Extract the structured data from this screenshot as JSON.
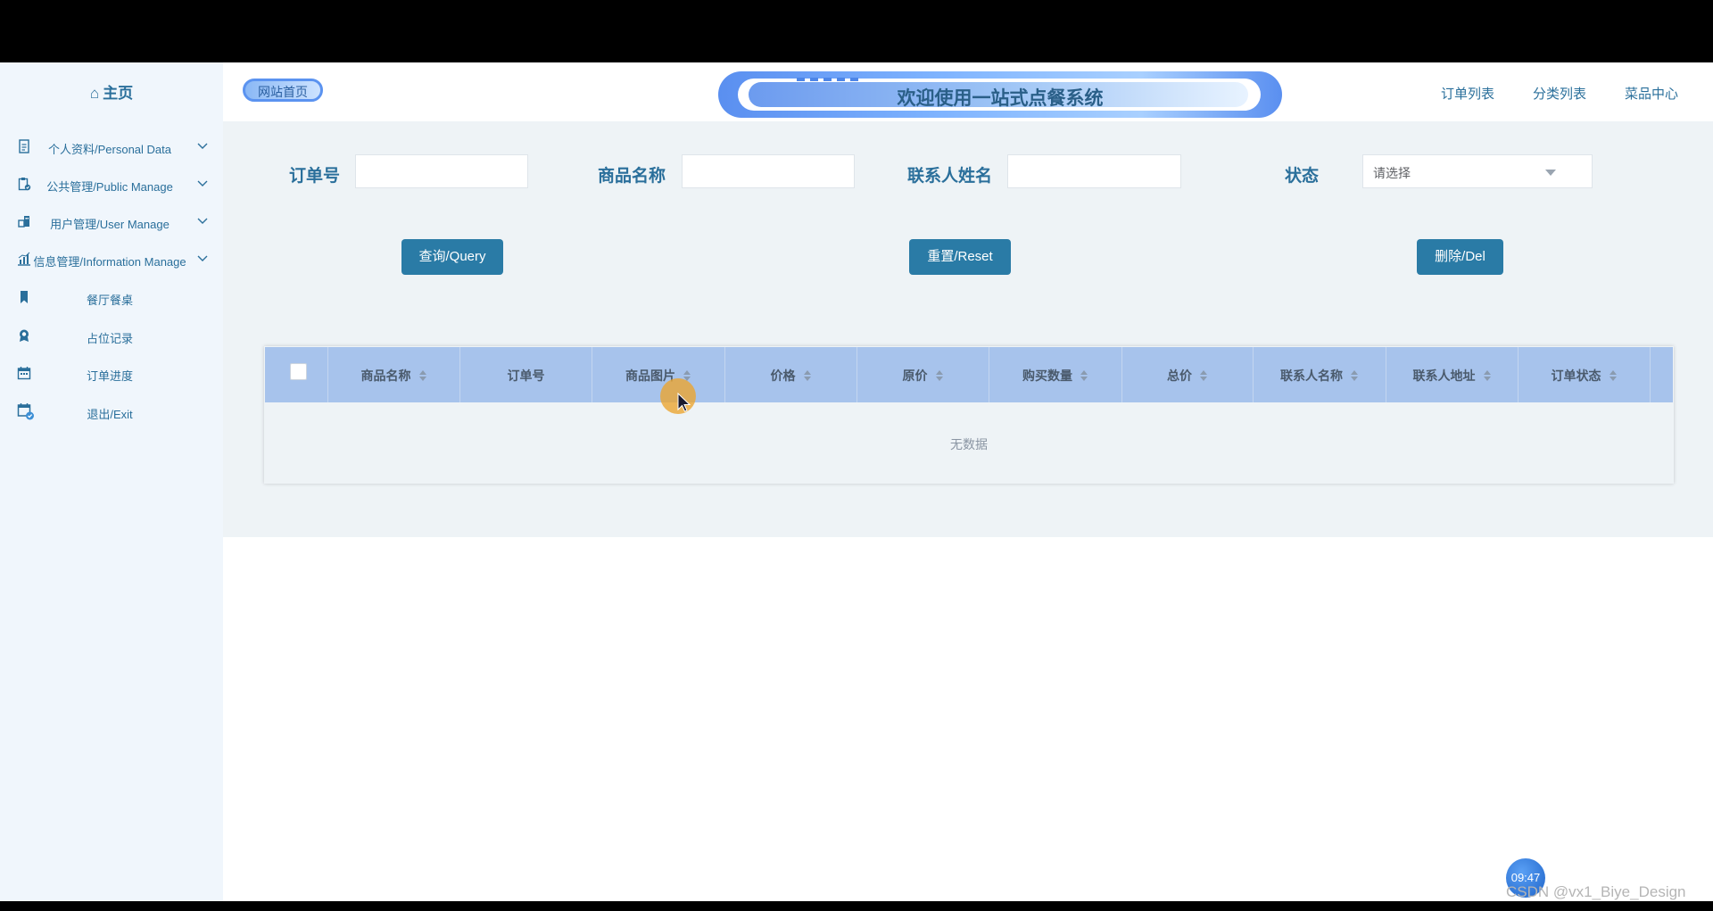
{
  "sidebar": {
    "home_label": "主页",
    "items": [
      {
        "label": "个人资料/Personal Data",
        "icon": "document-icon",
        "expandable": true
      },
      {
        "label": "公共管理/Public Manage",
        "icon": "clipboard-check-icon",
        "expandable": true
      },
      {
        "label": "用户管理/User Manage",
        "icon": "building-icon",
        "expandable": true
      },
      {
        "label": "信息管理/Information Manage",
        "icon": "bar-chart-icon",
        "expandable": true
      },
      {
        "label": "餐厅餐桌",
        "icon": "bookmark-icon",
        "expandable": false
      },
      {
        "label": "占位记录",
        "icon": "badge-icon",
        "expandable": false
      },
      {
        "label": "订单进度",
        "icon": "calendar-icon",
        "expandable": false
      },
      {
        "label": "退出/Exit",
        "icon": "calendar-check-icon",
        "expandable": false
      }
    ]
  },
  "header": {
    "home_button": "网站首页",
    "banner_title": "欢迎使用一站式点餐系统",
    "nav": [
      "订单列表",
      "分类列表",
      "菜品中心"
    ]
  },
  "search": {
    "fields": [
      {
        "label": "订单号",
        "value": ""
      },
      {
        "label": "商品名称",
        "value": ""
      },
      {
        "label": "联系人姓名",
        "value": ""
      }
    ],
    "status_label": "状态",
    "status_placeholder": "请选择"
  },
  "buttons": {
    "query": "查询/Query",
    "reset": "重置/Reset",
    "delete": "删除/Del"
  },
  "table": {
    "columns": [
      {
        "label": "商品名称",
        "sortable": true
      },
      {
        "label": "订单号",
        "sortable": false
      },
      {
        "label": "商品图片",
        "sortable": true
      },
      {
        "label": "价格",
        "sortable": true
      },
      {
        "label": "原价",
        "sortable": true
      },
      {
        "label": "购买数量",
        "sortable": true
      },
      {
        "label": "总价",
        "sortable": true
      },
      {
        "label": "联系人名称",
        "sortable": true
      },
      {
        "label": "联系人地址",
        "sortable": true
      },
      {
        "label": "订单状态",
        "sortable": true
      }
    ],
    "empty_text": "无数据"
  },
  "overlay": {
    "clock": "09:47",
    "watermark": "CSDN @vx1_Biye_Design"
  },
  "colors": {
    "accent": "#2a7ba6",
    "sidebar_bg": "#f0f6fc",
    "table_header": "#a7c3ec"
  }
}
